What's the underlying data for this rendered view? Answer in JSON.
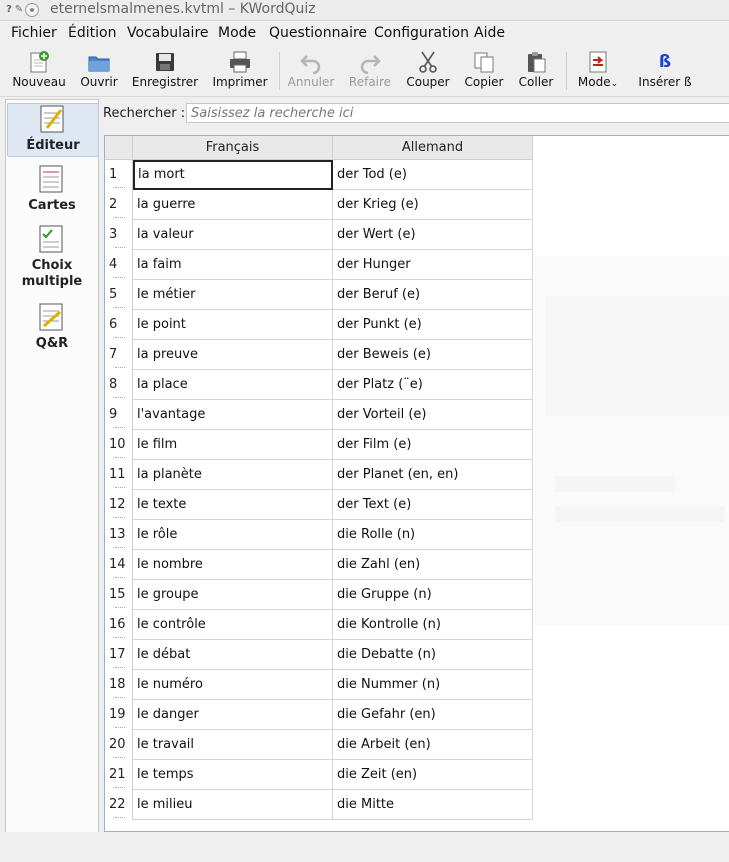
{
  "window": {
    "title": "eternelsmalmenes.kvtml – KWordQuiz"
  },
  "menubar": [
    "Fichier",
    "Édition",
    "Vocabulaire",
    "Mode",
    "Questionnaire",
    "Configuration",
    "Aide"
  ],
  "toolbar": {
    "new": "Nouveau",
    "open": "Ouvrir",
    "save": "Enregistrer",
    "print": "Imprimer",
    "undo": "Annuler",
    "redo": "Refaire",
    "cut": "Couper",
    "copy": "Copier",
    "paste": "Coller",
    "mode": "Mode",
    "insert": "Insérer ß",
    "insert_glyph": "ß"
  },
  "sidebar": {
    "items": [
      {
        "label": "Éditeur",
        "active": true
      },
      {
        "label": "Cartes",
        "active": false
      },
      {
        "label": "Choix multiple",
        "active": false
      },
      {
        "label": "Q&R",
        "active": false
      }
    ]
  },
  "search": {
    "label": "Rechercher :",
    "placeholder": "Saisissez la recherche ici"
  },
  "table": {
    "columns": [
      "Français",
      "Allemand"
    ],
    "rows": [
      {
        "n": "1",
        "fr": "la mort",
        "de": "der Tod (e)"
      },
      {
        "n": "2",
        "fr": "la guerre",
        "de": "der Krieg (e)"
      },
      {
        "n": "3",
        "fr": "la valeur",
        "de": "der Wert (e)"
      },
      {
        "n": "4",
        "fr": "la faim",
        "de": "der Hunger"
      },
      {
        "n": "5",
        "fr": "le métier",
        "de": "der Beruf (e)"
      },
      {
        "n": "6",
        "fr": "le point",
        "de": "der Punkt (e)"
      },
      {
        "n": "7",
        "fr": "la preuve",
        "de": "der Beweis (e)"
      },
      {
        "n": "8",
        "fr": "la place",
        "de": "der Platz (¨e)"
      },
      {
        "n": "9",
        "fr": "l'avantage",
        "de": "der Vorteil (e)"
      },
      {
        "n": "10",
        "fr": "le film",
        "de": "der Film (e)"
      },
      {
        "n": "11",
        "fr": "la planète",
        "de": "der Planet (en, en)"
      },
      {
        "n": "12",
        "fr": "le texte",
        "de": "der Text (e)"
      },
      {
        "n": "13",
        "fr": "le rôle",
        "de": "die Rolle (n)"
      },
      {
        "n": "14",
        "fr": "le nombre",
        "de": "die Zahl (en)"
      },
      {
        "n": "15",
        "fr": "le groupe",
        "de": "die Gruppe (n)"
      },
      {
        "n": "16",
        "fr": "le contrôle",
        "de": "die Kontrolle (n)"
      },
      {
        "n": "17",
        "fr": "le débat",
        "de": "die Debatte (n)"
      },
      {
        "n": "18",
        "fr": "le numéro",
        "de": "die Nummer (n)"
      },
      {
        "n": "19",
        "fr": "le danger",
        "de": "die Gefahr (en)"
      },
      {
        "n": "20",
        "fr": "le travail",
        "de": "die Arbeit (en)"
      },
      {
        "n": "21",
        "fr": "le temps",
        "de": "die Zeit (en)"
      },
      {
        "n": "22",
        "fr": "le milieu",
        "de": "die Mitte"
      }
    ]
  },
  "colors": {
    "accent": "#2f64b5",
    "grid": "#d6d6d6",
    "selection_border": "#222222"
  }
}
